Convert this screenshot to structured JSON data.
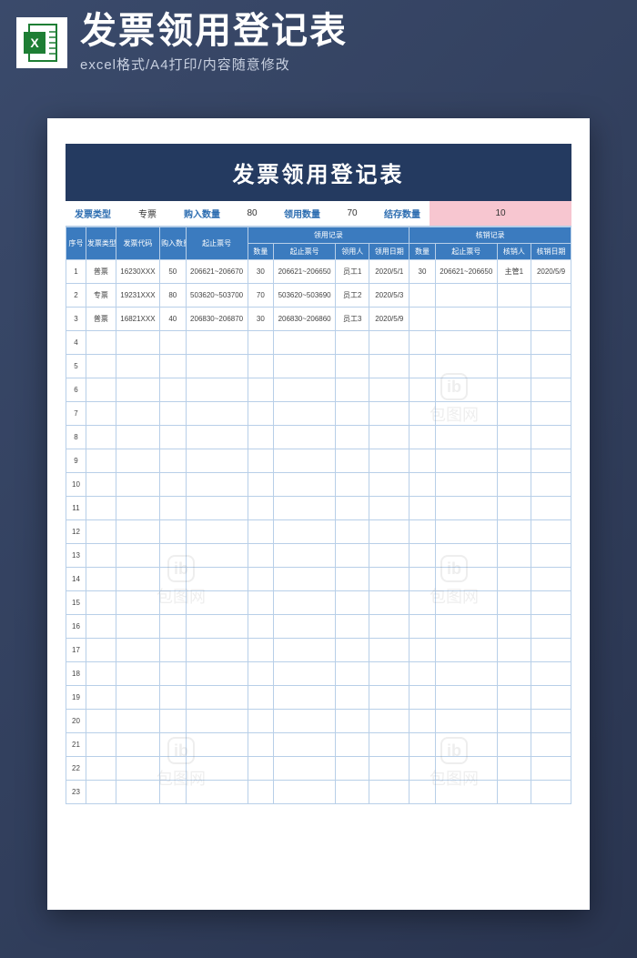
{
  "header": {
    "title": "发票领用登记表",
    "subtitle": "excel格式/A4打印/内容随意修改"
  },
  "doc": {
    "title": "发票领用登记表"
  },
  "summary": {
    "type_label": "发票类型",
    "type_value": "专票",
    "buy_label": "购入数量",
    "buy_value": "80",
    "use_label": "领用数量",
    "use_value": "70",
    "balance_label": "结存数量",
    "balance_value": "10"
  },
  "columns": {
    "seq": "序号",
    "type": "发票类型",
    "code": "发票代码",
    "buyqty": "购入数量",
    "range": "起止票号",
    "use_group": "领用记录",
    "use_qty": "数量",
    "use_range": "起止票号",
    "use_person": "领用人",
    "use_date": "领用日期",
    "verify_group": "核销记录",
    "verify_qty": "数量",
    "verify_range": "起止票号",
    "verify_person": "核销人",
    "verify_date": "核销日期"
  },
  "rows": [
    {
      "seq": "1",
      "type": "普票",
      "code": "16230XXX",
      "buyqty": "50",
      "range": "206621~206670",
      "uqty": "30",
      "urange": "206621~206650",
      "uperson": "员工1",
      "udate": "2020/5/1",
      "vqty": "30",
      "vrange": "206621~206650",
      "vperson": "主管1",
      "vdate": "2020/5/9"
    },
    {
      "seq": "2",
      "type": "专票",
      "code": "19231XXX",
      "buyqty": "80",
      "range": "503620~503700",
      "uqty": "70",
      "urange": "503620~503690",
      "uperson": "员工2",
      "udate": "2020/5/3",
      "vqty": "",
      "vrange": "",
      "vperson": "",
      "vdate": ""
    },
    {
      "seq": "3",
      "type": "普票",
      "code": "16821XXX",
      "buyqty": "40",
      "range": "206830~206870",
      "uqty": "30",
      "urange": "206830~206860",
      "uperson": "员工3",
      "udate": "2020/5/9",
      "vqty": "",
      "vrange": "",
      "vperson": "",
      "vdate": ""
    },
    {
      "seq": "4"
    },
    {
      "seq": "5"
    },
    {
      "seq": "6"
    },
    {
      "seq": "7"
    },
    {
      "seq": "8"
    },
    {
      "seq": "9"
    },
    {
      "seq": "10"
    },
    {
      "seq": "11"
    },
    {
      "seq": "12"
    },
    {
      "seq": "13"
    },
    {
      "seq": "14"
    },
    {
      "seq": "15"
    },
    {
      "seq": "16"
    },
    {
      "seq": "17"
    },
    {
      "seq": "18"
    },
    {
      "seq": "19"
    },
    {
      "seq": "20"
    },
    {
      "seq": "21"
    },
    {
      "seq": "22"
    },
    {
      "seq": "23"
    }
  ],
  "watermark": "包图网"
}
